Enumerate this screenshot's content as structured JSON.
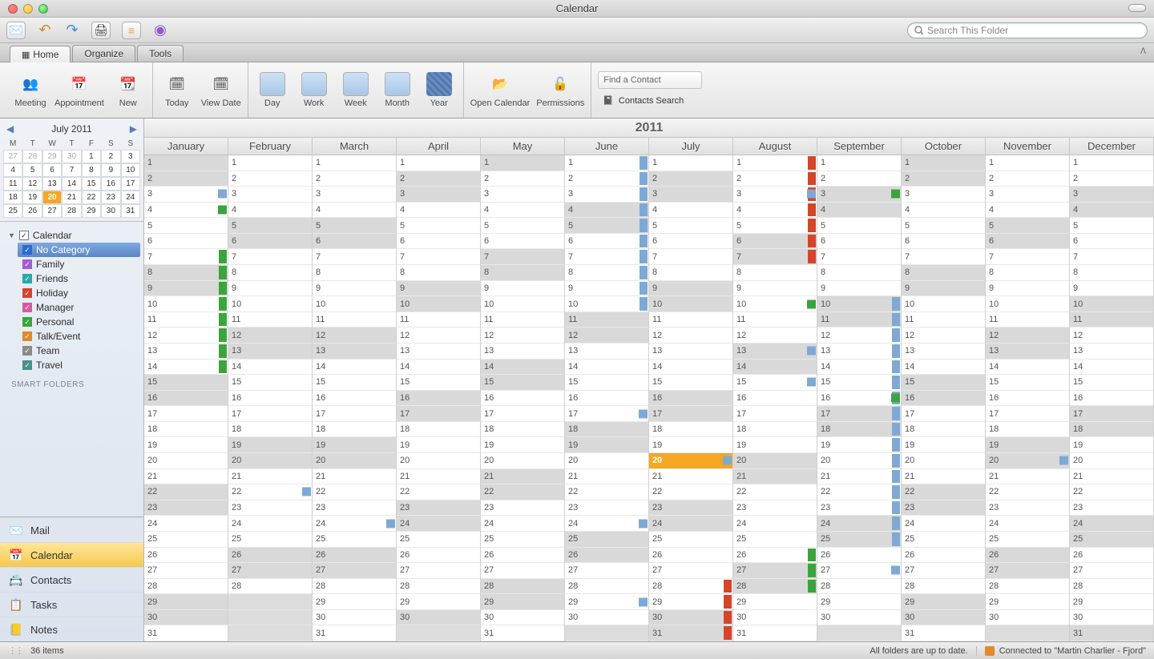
{
  "window_title": "Calendar",
  "search_placeholder": "Search This Folder",
  "tabs": {
    "home": "Home",
    "organize": "Organize",
    "tools": "Tools"
  },
  "ribbon": {
    "meeting": "Meeting",
    "appointment": "Appointment",
    "new": "New",
    "today": "Today",
    "viewdate": "View Date",
    "day": "Day",
    "work": "Work",
    "week": "Week",
    "month": "Month",
    "year": "Year",
    "opencal": "Open Calendar",
    "perms": "Permissions",
    "findcontact": "Find a Contact",
    "contactsearch": "Contacts Search"
  },
  "mini": {
    "title": "July 2011",
    "dow": [
      "M",
      "T",
      "W",
      "T",
      "F",
      "S",
      "S"
    ],
    "cells": [
      {
        "d": 27,
        "o": true
      },
      {
        "d": 28,
        "o": true
      },
      {
        "d": 29,
        "o": true
      },
      {
        "d": 30,
        "o": true
      },
      {
        "d": 1
      },
      {
        "d": 2
      },
      {
        "d": 3
      },
      {
        "d": 4
      },
      {
        "d": 5
      },
      {
        "d": 6
      },
      {
        "d": 7
      },
      {
        "d": 8
      },
      {
        "d": 9
      },
      {
        "d": 10
      },
      {
        "d": 11
      },
      {
        "d": 12
      },
      {
        "d": 13
      },
      {
        "d": 14
      },
      {
        "d": 15
      },
      {
        "d": 16
      },
      {
        "d": 17
      },
      {
        "d": 18
      },
      {
        "d": 19
      },
      {
        "d": 20,
        "t": true
      },
      {
        "d": 21
      },
      {
        "d": 22
      },
      {
        "d": 23
      },
      {
        "d": 24
      },
      {
        "d": 25
      },
      {
        "d": 26
      },
      {
        "d": 27
      },
      {
        "d": 28
      },
      {
        "d": 29
      },
      {
        "d": 30
      },
      {
        "d": 31
      }
    ]
  },
  "tree": {
    "root": "Calendar",
    "items": [
      {
        "label": "No Category",
        "cls": "cat-blue",
        "sel": true
      },
      {
        "label": "Family",
        "cls": "cat-purple"
      },
      {
        "label": "Friends",
        "cls": "cat-teal"
      },
      {
        "label": "Holiday",
        "cls": "cat-red"
      },
      {
        "label": "Manager",
        "cls": "cat-pink"
      },
      {
        "label": "Personal",
        "cls": "cat-green"
      },
      {
        "label": "Talk/Event",
        "cls": "cat-orange"
      },
      {
        "label": "Team",
        "cls": "cat-gray"
      },
      {
        "label": "Travel",
        "cls": "cat-dkteal"
      }
    ],
    "smart": "SMART FOLDERS"
  },
  "nav": {
    "mail": "Mail",
    "calendar": "Calendar",
    "contacts": "Contacts",
    "tasks": "Tasks",
    "notes": "Notes"
  },
  "year": "2011",
  "months": [
    "January",
    "February",
    "March",
    "April",
    "May",
    "June",
    "July",
    "August",
    "September",
    "October",
    "November",
    "December"
  ],
  "monthdata": [
    {
      "start": 5,
      "len": 31,
      "events": [
        {
          "d": 3,
          "c": "blue",
          "sq": true
        },
        {
          "d": 4,
          "c": "green",
          "sq": true
        },
        {
          "d": 7,
          "c": "green",
          "span": 8
        }
      ]
    },
    {
      "start": 1,
      "len": 28,
      "events": [
        {
          "d": 22,
          "c": "blue",
          "sq": true
        }
      ]
    },
    {
      "start": 1,
      "len": 31,
      "events": [
        {
          "d": 24,
          "c": "blue",
          "sq": true
        }
      ]
    },
    {
      "start": 4,
      "len": 30,
      "events": []
    },
    {
      "start": 6,
      "len": 31,
      "events": []
    },
    {
      "start": 2,
      "len": 30,
      "events": [
        {
          "d": 1,
          "c": "blue",
          "span": 10
        },
        {
          "d": 17,
          "c": "blue",
          "sq": true
        },
        {
          "d": 24,
          "c": "blue",
          "sq": true
        },
        {
          "d": 29,
          "c": "blue",
          "sq": true
        }
      ]
    },
    {
      "start": 4,
      "len": 31,
      "today": 20,
      "events": [
        {
          "d": 20,
          "c": "blue",
          "sq": true
        },
        {
          "d": 28,
          "c": "red",
          "span": 4
        }
      ]
    },
    {
      "start": 0,
      "len": 31,
      "events": [
        {
          "d": 1,
          "c": "red",
          "span": 7
        },
        {
          "d": 3,
          "c": "blue",
          "sq": true
        },
        {
          "d": 10,
          "c": "green",
          "sq": true
        },
        {
          "d": 13,
          "c": "blue",
          "sq": true
        },
        {
          "d": 15,
          "c": "blue",
          "sq": true
        },
        {
          "d": 26,
          "c": "green",
          "span": 3
        }
      ]
    },
    {
      "start": 3,
      "len": 30,
      "events": [
        {
          "d": 3,
          "c": "green",
          "sq": true
        },
        {
          "d": 10,
          "c": "blue",
          "span": 16
        },
        {
          "d": 16,
          "c": "green",
          "sq": true
        },
        {
          "d": 27,
          "c": "blue",
          "sq": true
        }
      ]
    },
    {
      "start": 5,
      "len": 31,
      "events": []
    },
    {
      "start": 1,
      "len": 30,
      "events": [
        {
          "d": 20,
          "c": "blue",
          "sq": true
        }
      ]
    },
    {
      "start": 3,
      "len": 31,
      "events": []
    }
  ],
  "status": {
    "items": "36 items",
    "sync": "All folders are up to date.",
    "conn": "Connected to \"Martin Charlier - Fjord\""
  }
}
